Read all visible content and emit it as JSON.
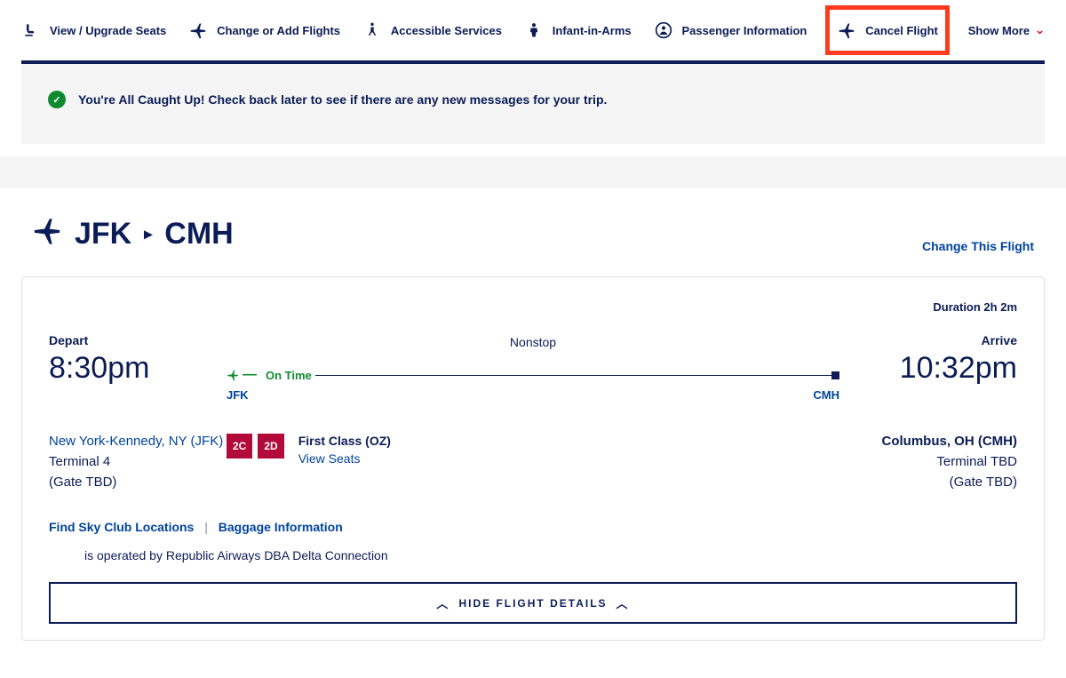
{
  "actions": {
    "seats": "View / Upgrade Seats",
    "change_add": "Change or Add Flights",
    "accessible": "Accessible Services",
    "infant": "Infant-in-Arms",
    "passenger": "Passenger Information",
    "cancel": "Cancel Flight",
    "show_more": "Show More"
  },
  "notice": "You're All Caught Up! Check back later to see if there are any new messages for your trip.",
  "route": {
    "origin_code": "JFK",
    "dest_code": "CMH",
    "change_link": "Change This Flight"
  },
  "flight": {
    "duration": "Duration 2h 2m",
    "depart_label": "Depart",
    "arrive_label": "Arrive",
    "depart_time": "8:30pm",
    "arrive_time": "10:32pm",
    "nonstop": "Nonstop",
    "status": "On Time",
    "origin_code": "JFK",
    "dest_code": "CMH",
    "origin_airport": "New York-Kennedy, NY (JFK)",
    "origin_terminal": "Terminal 4",
    "origin_gate": "(Gate TBD)",
    "dest_airport": "Columbus, OH (CMH)",
    "dest_terminal": "Terminal TBD",
    "dest_gate": "(Gate TBD)",
    "seat1": "2C",
    "seat2": "2D",
    "cabin": "First Class (OZ)",
    "view_seats": "View Seats",
    "skyclub_link": "Find Sky Club Locations",
    "baggage_link": "Baggage Information",
    "operator": "is operated by Republic Airways DBA Delta Connection",
    "toggle": "HIDE FLIGHT DETAILS"
  }
}
